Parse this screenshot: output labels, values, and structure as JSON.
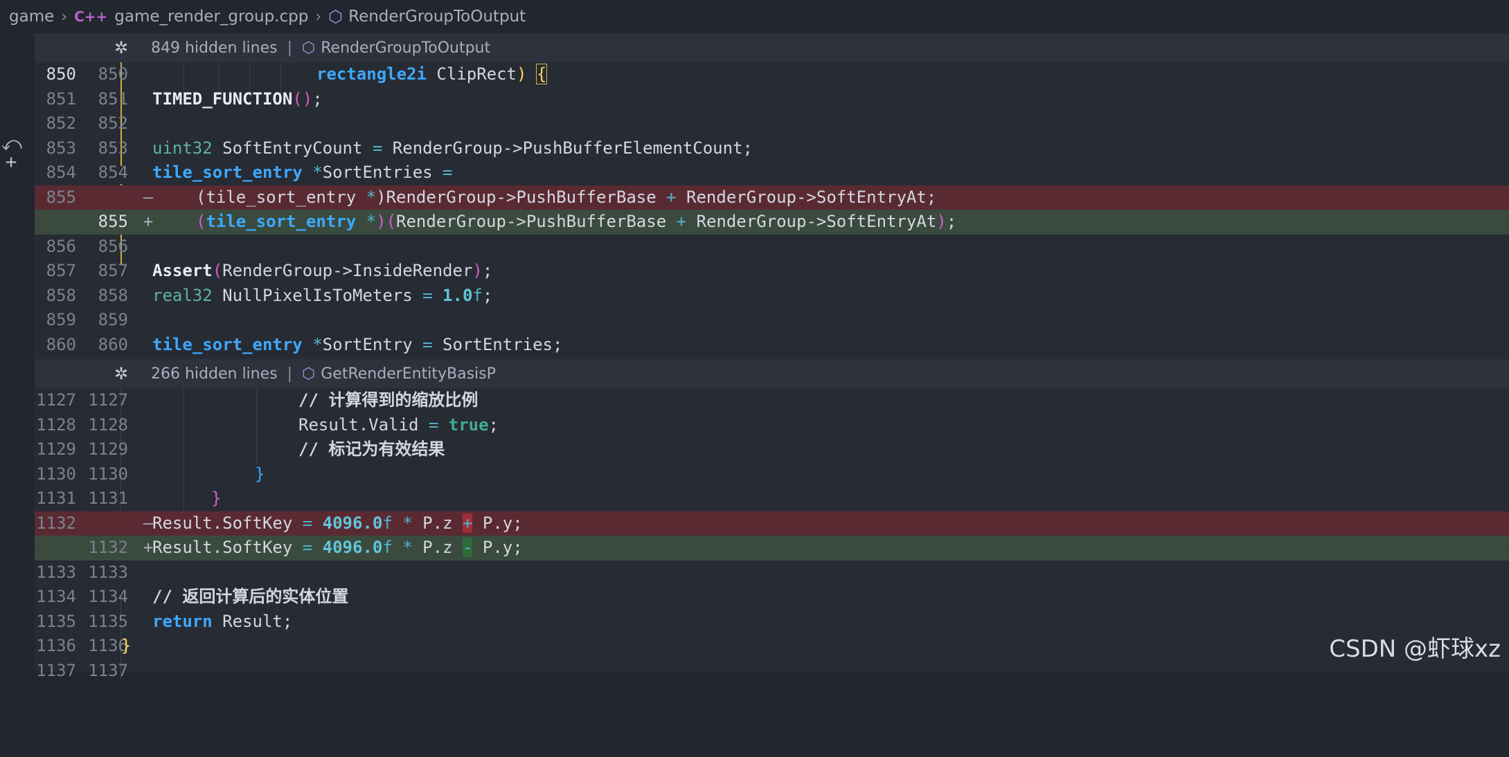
{
  "breadcrumb": {
    "folder": "game",
    "lang_badge": "C++",
    "file": "game_render_group.cpp",
    "symbol": "RenderGroupToOutput"
  },
  "hidden_bars": [
    {
      "count_text": "849 hidden lines",
      "symbol": "RenderGroupToOutput"
    },
    {
      "count_text": "266 hidden lines",
      "symbol": "GetRenderEntityBasisP"
    }
  ],
  "gutter_icons": [
    "revert-icon",
    "plus-icon"
  ],
  "lines1": [
    {
      "old": "850",
      "new": "850",
      "type": "ctx"
    },
    {
      "old": "851",
      "new": "851",
      "type": "ctx"
    },
    {
      "old": "852",
      "new": "852",
      "type": "ctx"
    },
    {
      "old": "853",
      "new": "853",
      "type": "ctx"
    },
    {
      "old": "854",
      "new": "854",
      "type": "ctx"
    },
    {
      "old": "855",
      "new": "",
      "type": "del",
      "marker": "—"
    },
    {
      "old": "",
      "new": "855",
      "type": "add",
      "marker": "+"
    },
    {
      "old": "856",
      "new": "856",
      "type": "ctx"
    },
    {
      "old": "857",
      "new": "857",
      "type": "ctx"
    },
    {
      "old": "858",
      "new": "858",
      "type": "ctx"
    },
    {
      "old": "859",
      "new": "859",
      "type": "ctx"
    },
    {
      "old": "860",
      "new": "860",
      "type": "ctx"
    }
  ],
  "lines2": [
    {
      "old": "1127",
      "new": "1127",
      "type": "ctx"
    },
    {
      "old": "1128",
      "new": "1128",
      "type": "ctx"
    },
    {
      "old": "1129",
      "new": "1129",
      "type": "ctx"
    },
    {
      "old": "1130",
      "new": "1130",
      "type": "ctx"
    },
    {
      "old": "1131",
      "new": "1131",
      "type": "ctx"
    },
    {
      "old": "1132",
      "new": "",
      "type": "del",
      "marker": "—"
    },
    {
      "old": "",
      "new": "1132",
      "type": "add",
      "marker": "+"
    },
    {
      "old": "1133",
      "new": "1133",
      "type": "ctx"
    },
    {
      "old": "1134",
      "new": "1134",
      "type": "ctx"
    },
    {
      "old": "1135",
      "new": "1135",
      "type": "ctx"
    },
    {
      "old": "1136",
      "new": "1136",
      "type": "ctx"
    },
    {
      "old": "1137",
      "new": "1137",
      "type": "ctx"
    }
  ],
  "code": {
    "l850": {
      "t1": "rectangle2i",
      "t2": " ClipRect",
      "t3": ")",
      "t4": " ",
      "t5": "{"
    },
    "l851": {
      "fn": "TIMED_FUNCTION",
      "p": "()",
      "s": ";"
    },
    "l853": {
      "typ": "uint32",
      "rest": " SoftEntryCount ",
      "op": "=",
      "rest2": " RenderGroup->PushBufferElementCount;"
    },
    "l854": {
      "kw": "tile_sort_entry",
      "rest": " ",
      "op": "*",
      "rest2": "SortEntries ",
      "op2": "="
    },
    "l855del": {
      "a": "(tile_sort_entry ",
      "op": "*",
      "b": ")RenderGroup->PushBufferBase ",
      "op2": "+",
      "c": " RenderGroup->SoftEntryAt;"
    },
    "l855add": {
      "p1": "(",
      "kw": "tile_sort_entry",
      "sp": " ",
      "op": "*",
      "p2": ")",
      "p3": "(",
      "a": "RenderGroup->PushBufferBase ",
      "op2": "+",
      "b": " RenderGroup->SoftEntryAt",
      "p4": ")",
      "s": ";"
    },
    "l857": {
      "fn": "Assert",
      "p1": "(",
      "a": "RenderGroup->InsideRender",
      "p2": ")",
      "s": ";"
    },
    "l858": {
      "typ": "real32",
      "rest": " NullPixelIsToMeters ",
      "op": "=",
      "sp": " ",
      "num": "1.0",
      "f": "f",
      "s": ";"
    },
    "l860": {
      "kw": "tile_sort_entry",
      "sp": " ",
      "op": "*",
      "rest": "SortEntry ",
      "op2": "=",
      "rest2": " SortEntries;"
    },
    "l1127": {
      "cmt": "// 计算得到的缩放比例"
    },
    "l1128": {
      "a": "Result.Valid ",
      "op": "=",
      "sp": " ",
      "b": "true",
      "s": ";"
    },
    "l1129": {
      "cmt": "// 标记为有效结果"
    },
    "l1130": {
      "b": "}"
    },
    "l1131": {
      "b": "}"
    },
    "l1132del": {
      "a": "Result.SoftKey ",
      "op": "=",
      "sp": " ",
      "num": "4096.0",
      "f": "f",
      "sp2": " ",
      "op2": "*",
      "b": " P.z ",
      "hl": "+",
      "c": " P.y;"
    },
    "l1132add": {
      "a": "Result.SoftKey ",
      "op": "=",
      "sp": " ",
      "num": "4096.0",
      "f": "f",
      "sp2": " ",
      "op2": "*",
      "b": " P.z ",
      "hl": "-",
      "c": " P.y;"
    },
    "l1134": {
      "cmt": "// 返回计算后的实体位置"
    },
    "l1135": {
      "kw": "return",
      "rest": " Result;"
    },
    "l1136": {
      "b": "}"
    }
  },
  "watermark": "CSDN @虾球xz"
}
